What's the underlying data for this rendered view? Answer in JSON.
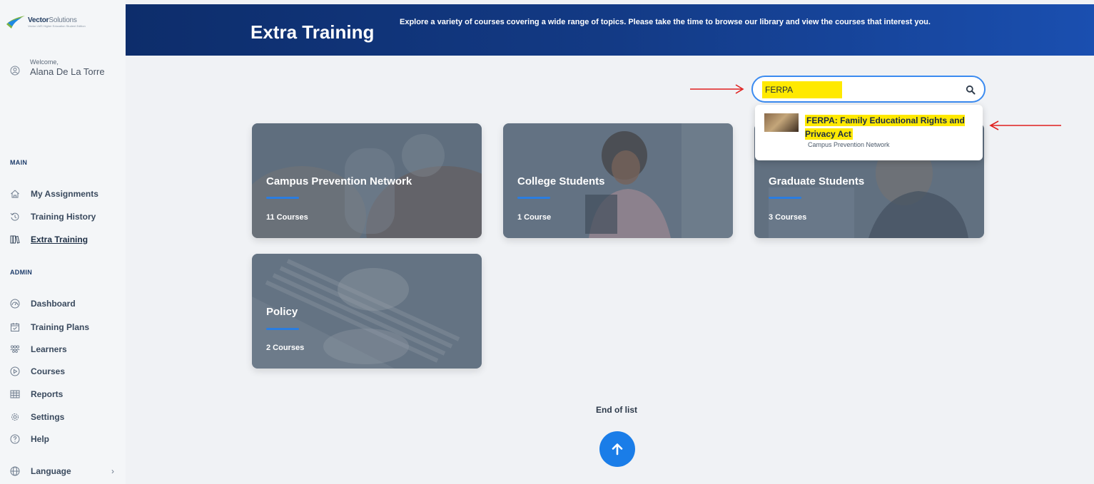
{
  "sidebar": {
    "logo": {
      "brand": "Vector",
      "brand_light": "Solutions",
      "tagline": "Vector LMS Higher Education Student Edition"
    },
    "welcome_label": "Welcome,",
    "user_name": "Alana De La Torre",
    "sections": {
      "main": "MAIN",
      "admin": "ADMIN"
    },
    "main_items": [
      {
        "label": "My Assignments",
        "icon": "home-icon"
      },
      {
        "label": "Training History",
        "icon": "history-icon"
      },
      {
        "label": "Extra Training",
        "icon": "books-icon",
        "active": true
      }
    ],
    "admin_items": [
      {
        "label": "Dashboard",
        "icon": "gauge-icon"
      },
      {
        "label": "Training Plans",
        "icon": "calendar-check-icon"
      },
      {
        "label": "Learners",
        "icon": "users-icon"
      },
      {
        "label": "Courses",
        "icon": "play-circle-icon"
      },
      {
        "label": "Reports",
        "icon": "table-icon"
      },
      {
        "label": "Settings",
        "icon": "gear-icon"
      },
      {
        "label": "Help",
        "icon": "help-circle-icon"
      }
    ],
    "language_label": "Language",
    "language_chevron": "›"
  },
  "header": {
    "title": "Extra Training",
    "description": "Explore a variety of courses covering a wide range of topics. Please take the time to browse our library and view the courses that interest you."
  },
  "search": {
    "value": "FERPA",
    "results": [
      {
        "title": "FERPA: Family Educational Rights and Privacy Act",
        "subtitle": "Campus Prevention Network"
      }
    ]
  },
  "categories": [
    {
      "title": "Campus Prevention Network",
      "count": "11 Courses"
    },
    {
      "title": "College Students",
      "count": "1 Course"
    },
    {
      "title": "Graduate Students",
      "count": "3 Courses"
    },
    {
      "title": "Policy",
      "count": "2 Courses"
    }
  ],
  "footer": {
    "end_text": "End of list"
  },
  "colors": {
    "header_start": "#0d2d6b",
    "header_end": "#1a4fb0",
    "accent": "#2a7de1",
    "highlight": "#ffe900",
    "annotation_arrow": "#e0201e"
  }
}
